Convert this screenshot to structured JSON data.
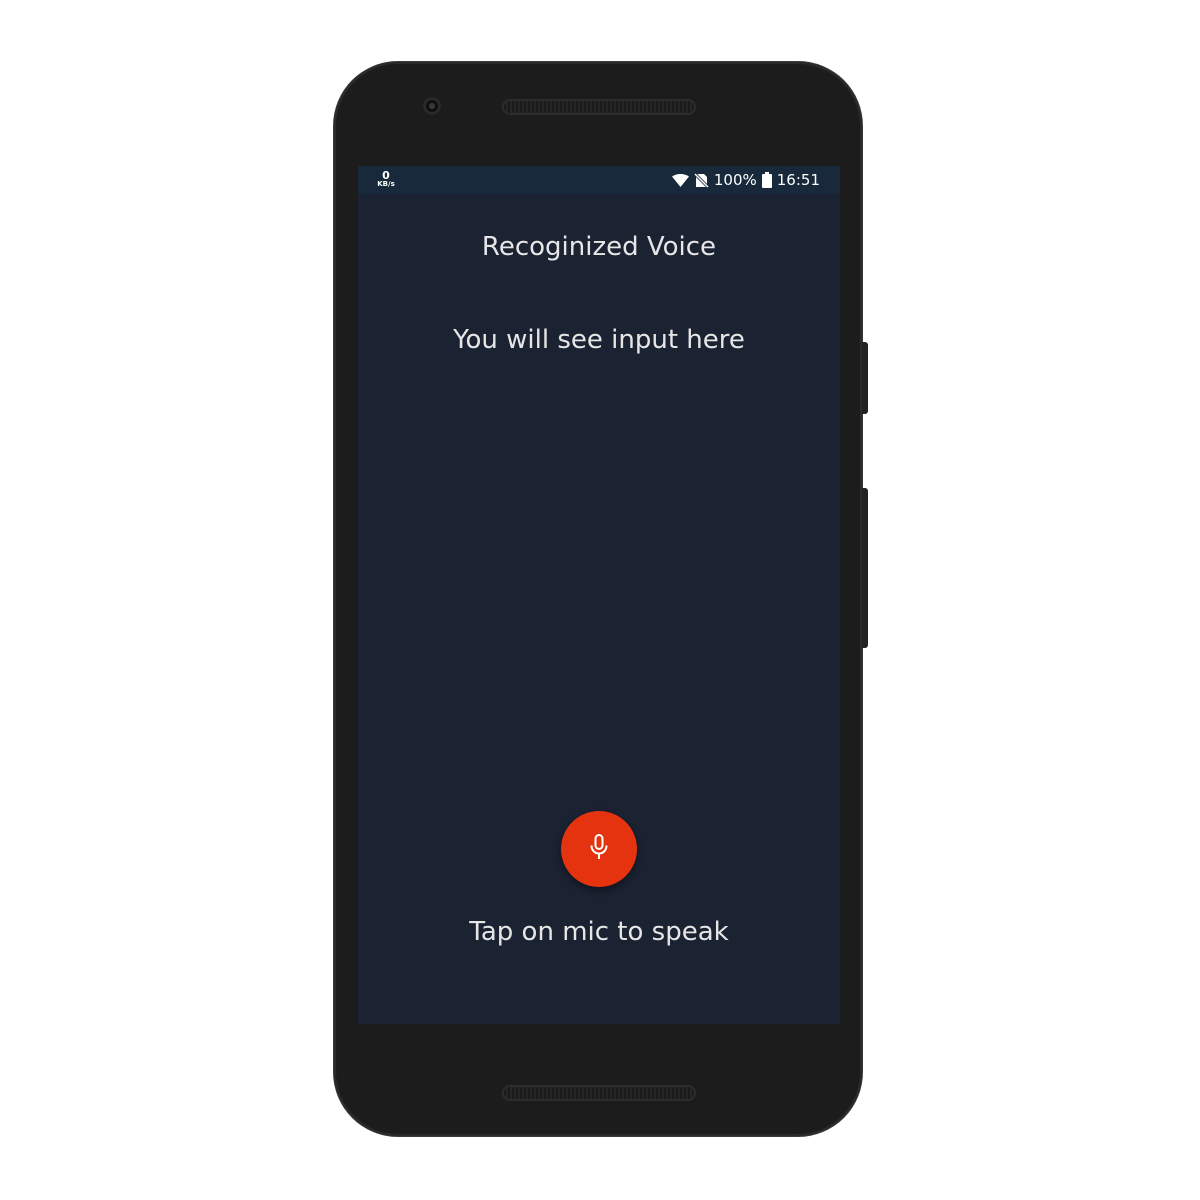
{
  "status_bar": {
    "net_speed_value": "0",
    "net_speed_unit": "KB/s",
    "battery": "100%",
    "time": "16:51",
    "icons": [
      "wifi-icon",
      "no-sim-icon",
      "battery-icon"
    ]
  },
  "main": {
    "title": "Recoginized Voice",
    "recognized_text": "You will see input here",
    "mic_icon": "microphone-icon",
    "hint": "Tap on mic to speak"
  },
  "colors": {
    "screen_background": "#1b2232",
    "status_bar_background": "#17293a",
    "mic_button": "#e5330f",
    "text": "#e6e6e6"
  }
}
